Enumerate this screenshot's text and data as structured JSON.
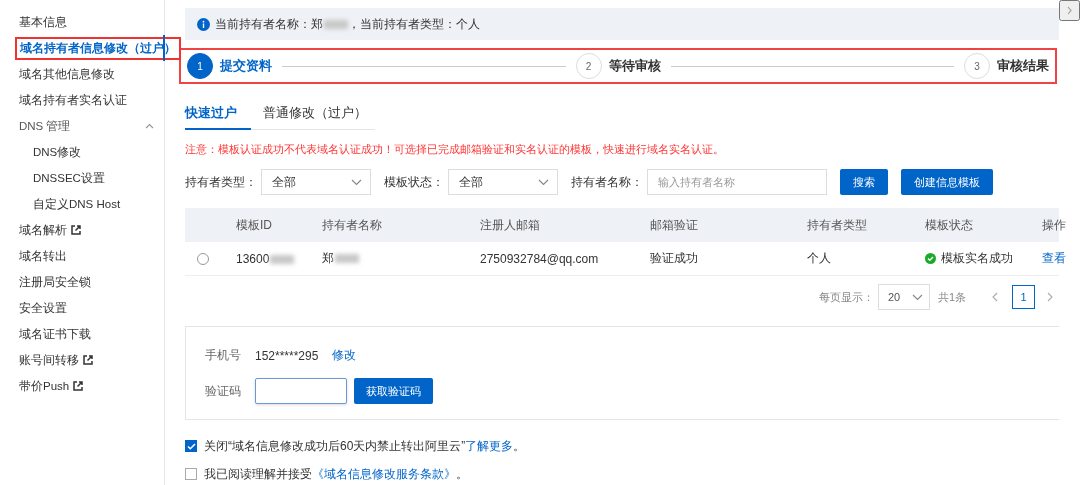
{
  "sidebar": {
    "items": [
      {
        "kind": "item",
        "label": "基本信息",
        "selected": false,
        "external": false,
        "highlighted": false
      },
      {
        "kind": "item",
        "label": "域名持有者信息修改（过户）",
        "selected": true,
        "external": false,
        "highlighted": true
      },
      {
        "kind": "item",
        "label": "域名其他信息修改",
        "selected": false,
        "external": false,
        "highlighted": false
      },
      {
        "kind": "item",
        "label": "域名持有者实名认证",
        "selected": false,
        "external": false,
        "highlighted": false
      },
      {
        "kind": "group",
        "label": "DNS 管理",
        "expanded": true,
        "children": [
          {
            "label": "DNS修改",
            "selected": false
          },
          {
            "label": "DNSSEC设置",
            "selected": false
          },
          {
            "label": "自定义DNS Host",
            "selected": false
          }
        ]
      },
      {
        "kind": "item",
        "label": "域名解析",
        "selected": false,
        "external": true,
        "highlighted": false
      },
      {
        "kind": "item",
        "label": "域名转出",
        "selected": false,
        "external": false,
        "highlighted": false
      },
      {
        "kind": "item",
        "label": "注册局安全锁",
        "selected": false,
        "external": false,
        "highlighted": false
      },
      {
        "kind": "item",
        "label": "安全设置",
        "selected": false,
        "external": false,
        "highlighted": false
      },
      {
        "kind": "item",
        "label": "域名证书下载",
        "selected": false,
        "external": false,
        "highlighted": false
      },
      {
        "kind": "item",
        "label": "账号间转移",
        "selected": false,
        "external": true,
        "highlighted": false
      },
      {
        "kind": "item",
        "label": "带价Push",
        "selected": false,
        "external": true,
        "highlighted": false
      }
    ]
  },
  "info_banner": {
    "prefix": "当前持有者名称：郑",
    "redacted": true,
    "suffix": "，当前持有者类型：个人"
  },
  "steps": {
    "highlighted": true,
    "items": [
      {
        "number": "1",
        "label": "提交资料",
        "active": true
      },
      {
        "number": "2",
        "label": "等待审核",
        "active": false
      },
      {
        "number": "3",
        "label": "审核结果",
        "active": false
      }
    ]
  },
  "tabs": [
    {
      "label": "快速过户",
      "selected": true
    },
    {
      "label": "普通修改（过户）",
      "selected": false
    }
  ],
  "warning": "注意：模板认证成功不代表域名认证成功！可选择已完成邮箱验证和实名认证的模板，快速进行域名实名认证。",
  "filters": [
    {
      "kind": "select",
      "label": "持有者类型：",
      "value": "全部"
    },
    {
      "kind": "select",
      "label": "模板状态：",
      "value": "全部"
    },
    {
      "kind": "input",
      "label": "持有者名称：",
      "placeholder": "输入持有者名称"
    }
  ],
  "filter_buttons": [
    "搜索",
    "创建信息模板"
  ],
  "table": {
    "columns": [
      "模板ID",
      "持有者名称",
      "注册人邮箱",
      "邮箱验证",
      "持有者类型",
      "模板状态",
      "操作"
    ],
    "rows": [
      {
        "selected": false,
        "cells": [
          {
            "kind": "text",
            "text": "13600",
            "redacted": true
          },
          {
            "kind": "text",
            "text": "郑",
            "redacted": true
          },
          {
            "kind": "text",
            "text": "2750932784@qq.com",
            "redacted": false
          },
          {
            "kind": "text",
            "text": "验证成功",
            "redacted": false
          },
          {
            "kind": "text",
            "text": "个人",
            "redacted": false
          },
          {
            "kind": "status",
            "text": "模板实名成功"
          },
          {
            "kind": "link",
            "text": "查看"
          }
        ]
      }
    ]
  },
  "pagination": {
    "page_size_label": "每页显示：",
    "page_size": "20",
    "total": "共1条",
    "pages": [
      {
        "label": "1",
        "selected": true
      }
    ]
  },
  "phone_form": {
    "phone_label": "手机号",
    "phone": "152*****295",
    "edit_link": "修改",
    "code_label": "验证码",
    "get_code_button": "获取验证码"
  },
  "agreements": [
    {
      "checked": true,
      "text": "关闭“域名信息修改成功后60天内禁止转出阿里云”",
      "link": "了解更多",
      "suffix": "。"
    },
    {
      "checked": false,
      "text": "我已阅读理解并接受",
      "link": "《域名信息修改服务条款》",
      "suffix": "。"
    }
  ]
}
